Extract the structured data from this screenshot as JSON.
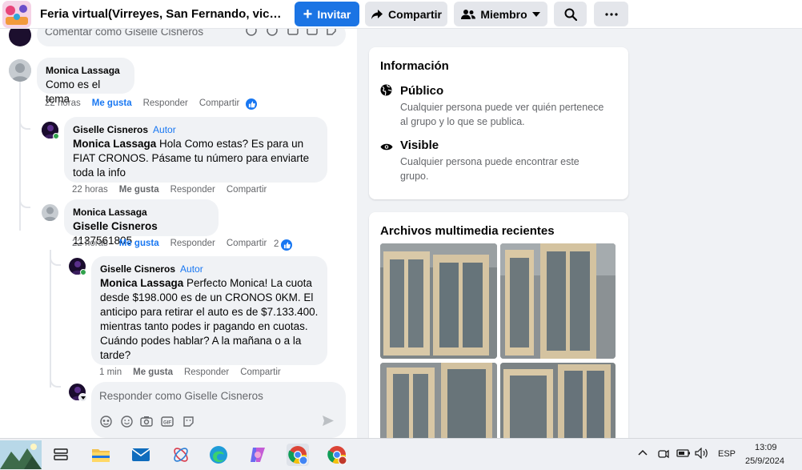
{
  "header": {
    "group_title": "Feria virtual(Virreyes, San Fernando, victo...",
    "invite_label": "Invitar",
    "share_label": "Compartir",
    "member_label": "Miembro",
    "search_icon": "search-icon",
    "more_icon": "more-icon"
  },
  "comments": {
    "top_placeholder": "Comentar como Giselle Cisneros",
    "items": [
      {
        "author": "Monica Lassaga",
        "badge": "",
        "mention": "",
        "text": "Como es el tema",
        "time": "22 horas",
        "like": "Me gusta",
        "reply": "Responder",
        "share": "Compartir",
        "reactions": ""
      },
      {
        "author": "Giselle Cisneros",
        "badge": "Autor",
        "mention": "Monica Lassaga",
        "text": " Hola Como estas? Es para un FIAT CRONOS. Pásame tu número para enviarte toda la info",
        "time": "22 horas",
        "like": "Me gusta",
        "reply": "Responder",
        "share": "Compartir",
        "reactions": ""
      },
      {
        "author": "Monica Lassaga",
        "badge": "",
        "mention": "Giselle Cisneros",
        "text": " 1137561805",
        "time": "22 horas",
        "like": "Me gusta",
        "reply": "Responder",
        "share": "Compartir",
        "reactions": "2"
      },
      {
        "author": "Giselle Cisneros",
        "badge": "Autor",
        "mention": "Monica Lassaga",
        "text": " Perfecto Monica! La cuota desde $198.000 es de un CRONOS 0KM. El anticipo para retirar el auto es de $7.133.400. mientras tanto podes ir pagando en cuotas. Cuándo podes hablar? A la mañana o a la tarde?",
        "time": "1 min",
        "like": "Me gusta",
        "reply": "Responder",
        "share": "Compartir",
        "reactions": ""
      }
    ],
    "reply_placeholder": "Responder como Giselle Cisneros"
  },
  "info_card": {
    "title": "Información",
    "public_title": "Público",
    "public_desc": "Cualquier persona puede ver quién pertenece al grupo y lo que se publica.",
    "visible_title": "Visible",
    "visible_desc": "Cualquier persona puede encontrar este grupo."
  },
  "media_card": {
    "title": "Archivos multimedia recientes"
  },
  "taskbar": {
    "language": "ESP",
    "time": "13:09",
    "date": "25/9/2024"
  },
  "colors": {
    "accent": "#1877f2",
    "primary_button": "#1b74e4",
    "online": "#31a24c"
  }
}
